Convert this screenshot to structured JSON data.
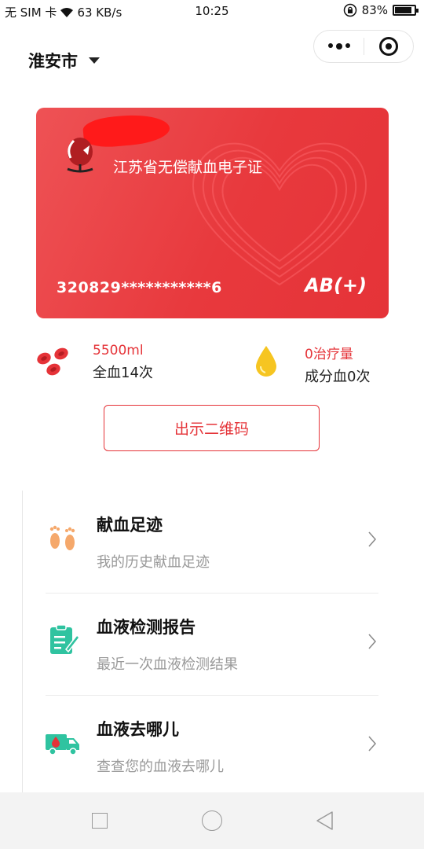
{
  "status_bar": {
    "carrier": "无 SIM 卡",
    "speed": "63 KB/s",
    "time": "10:25",
    "battery": "83%"
  },
  "header": {
    "city": "淮安市"
  },
  "card": {
    "title": "江苏省无偿献血电子证",
    "id_number": "320829***********6",
    "blood_type": "AB(+)"
  },
  "stats": {
    "whole_blood": {
      "amount": "5500ml",
      "count": "全血14次"
    },
    "component": {
      "amount": "0治疗量",
      "count": "成分血0次"
    }
  },
  "qr_button": {
    "label": "出示二维码"
  },
  "menu": [
    {
      "title": "献血足迹",
      "subtitle": "我的历史献血足迹",
      "icon": "footprints-icon"
    },
    {
      "title": "血液检测报告",
      "subtitle": "最近一次血液检测结果",
      "icon": "clipboard-report-icon"
    },
    {
      "title": "血液去哪儿",
      "subtitle": "查查您的血液去哪儿",
      "icon": "delivery-truck-icon"
    }
  ],
  "colors": {
    "accent": "#e53338",
    "card_gradient_start": "#ee5255",
    "card_gradient_end": "#e53338",
    "icon_orange": "#f5a86b",
    "icon_teal": "#2fc3a0"
  }
}
